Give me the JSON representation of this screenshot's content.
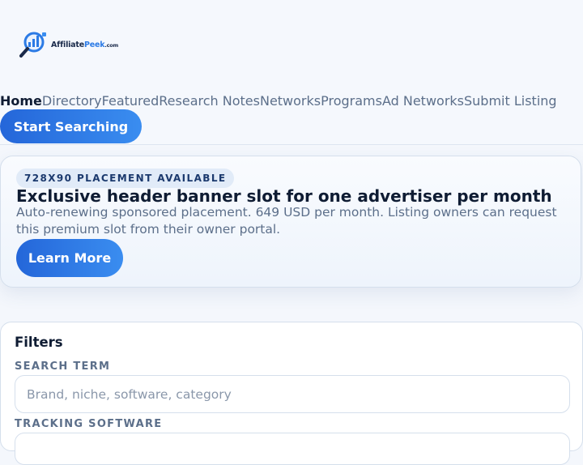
{
  "brand": {
    "logo_main": "Affiliate",
    "logo_accent": "Peek",
    "logo_tld": ".com"
  },
  "nav": {
    "items": [
      {
        "label": "Home"
      },
      {
        "label": "Directory"
      },
      {
        "label": "Featured"
      },
      {
        "label": "Research Notes"
      },
      {
        "label": "Networks"
      },
      {
        "label": "Programs"
      },
      {
        "label": "Ad Networks"
      },
      {
        "label": "Submit Listing"
      }
    ],
    "active": "Home"
  },
  "header": {
    "cta_label": "Start Searching"
  },
  "promo": {
    "badge": "728X90 PLACEMENT AVAILABLE",
    "title": "Exclusive header banner slot for one advertiser per month",
    "description": "Auto-renewing sponsored placement. 649 USD per month. Listing owners can request this premium slot from their owner portal.",
    "button_label": "Learn More"
  },
  "filters": {
    "title": "Filters",
    "search_label": "SEARCH TERM",
    "search_placeholder": "Brand, niche, software, category",
    "search_value": "",
    "tracking_label": "TRACKING SOFTWARE"
  },
  "colors": {
    "accent": "#2c7be5",
    "text_dark": "#0f1c33",
    "text_muted": "#5c6f8a",
    "border": "#d5dfec"
  }
}
